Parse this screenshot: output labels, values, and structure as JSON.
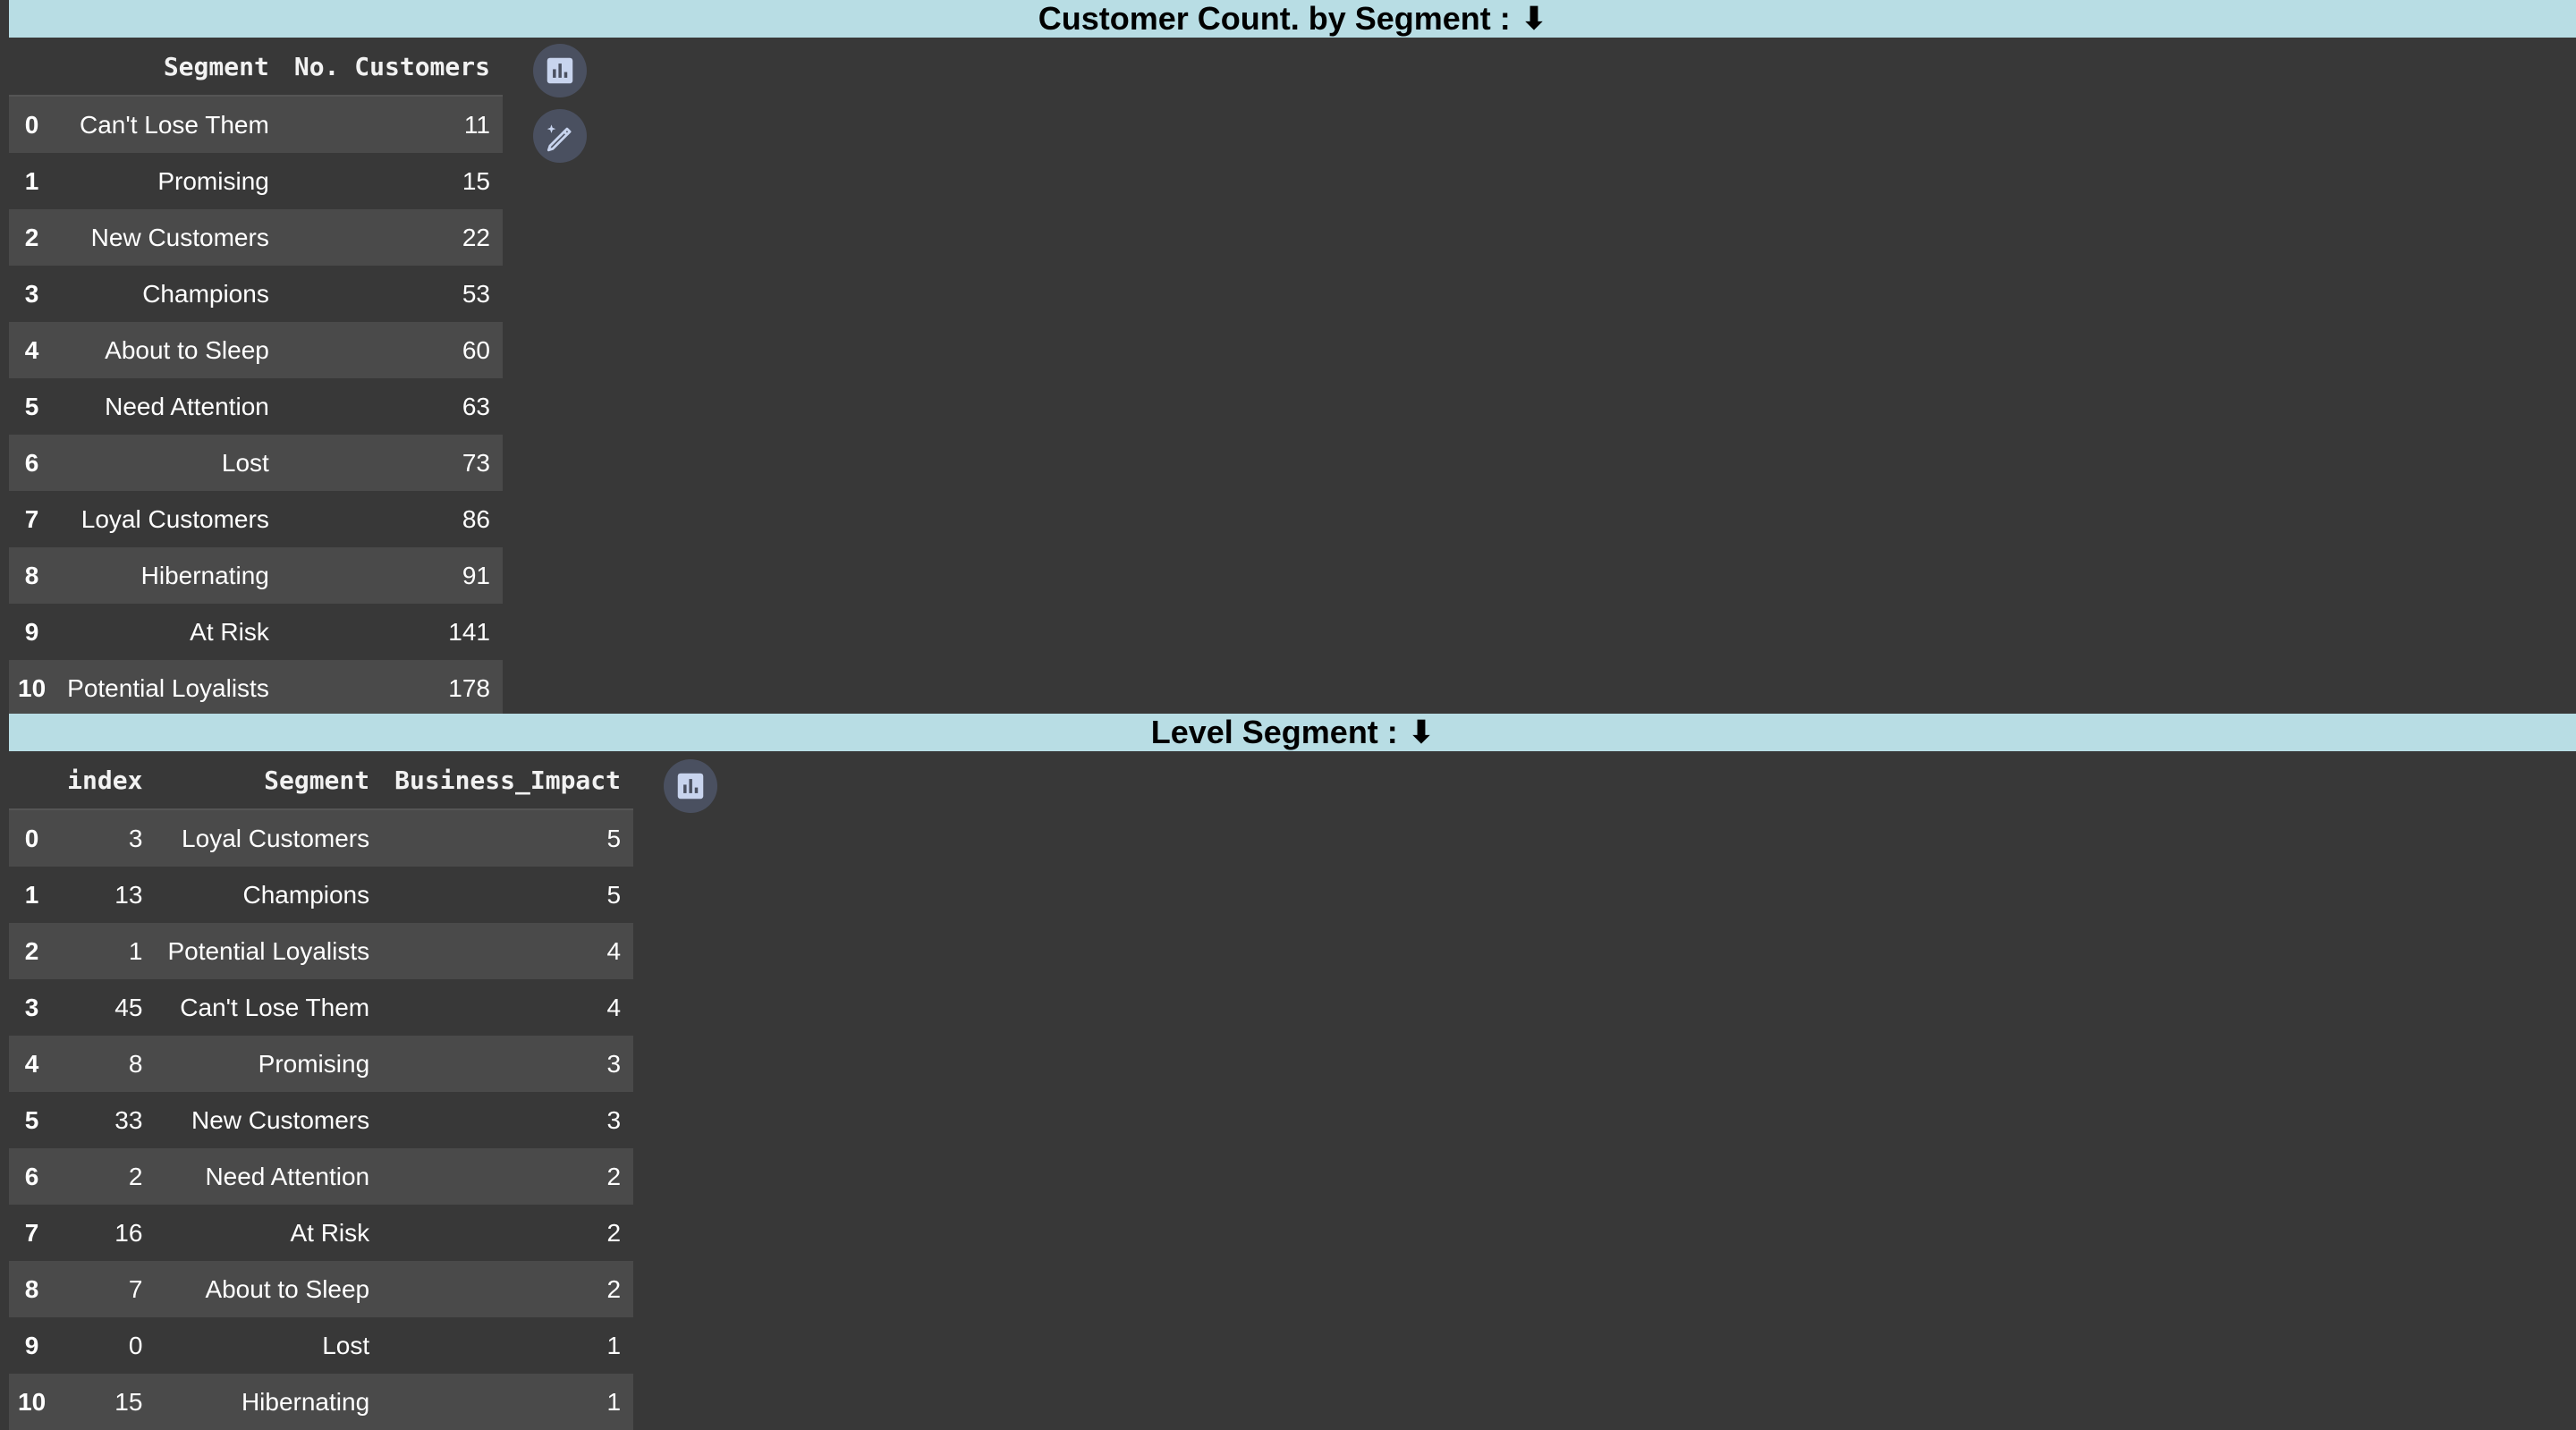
{
  "section1": {
    "title": "Customer Count. by Segment :",
    "arrow": "⬇",
    "columns": [
      "",
      "Segment",
      "No. Customers"
    ],
    "rows": [
      [
        "0",
        "Can't Lose Them",
        "11"
      ],
      [
        "1",
        "Promising",
        "15"
      ],
      [
        "2",
        "New Customers",
        "22"
      ],
      [
        "3",
        "Champions",
        "53"
      ],
      [
        "4",
        "About to Sleep",
        "60"
      ],
      [
        "5",
        "Need Attention",
        "63"
      ],
      [
        "6",
        "Lost",
        "73"
      ],
      [
        "7",
        "Loyal Customers",
        "86"
      ],
      [
        "8",
        "Hibernating",
        "91"
      ],
      [
        "9",
        "At Risk",
        "141"
      ],
      [
        "10",
        "Potential Loyalists",
        "178"
      ]
    ],
    "icons": [
      "bar-chart-icon",
      "magic-edit-icon"
    ]
  },
  "section2": {
    "title": "Level Segment :",
    "arrow": "⬇",
    "columns": [
      "",
      "index",
      "Segment",
      "Business_Impact"
    ],
    "rows": [
      [
        "0",
        "3",
        "Loyal Customers",
        "5"
      ],
      [
        "1",
        "13",
        "Champions",
        "5"
      ],
      [
        "2",
        "1",
        "Potential Loyalists",
        "4"
      ],
      [
        "3",
        "45",
        "Can't Lose Them",
        "4"
      ],
      [
        "4",
        "8",
        "Promising",
        "3"
      ],
      [
        "5",
        "33",
        "New Customers",
        "3"
      ],
      [
        "6",
        "2",
        "Need Attention",
        "2"
      ],
      [
        "7",
        "16",
        "At Risk",
        "2"
      ],
      [
        "8",
        "7",
        "About to Sleep",
        "2"
      ],
      [
        "9",
        "0",
        "Lost",
        "1"
      ],
      [
        "10",
        "15",
        "Hibernating",
        "1"
      ]
    ],
    "icons": [
      "bar-chart-icon"
    ]
  },
  "colors": {
    "banner_bg": "#b8dde4",
    "page_bg": "#383838",
    "row_alt": "#4a4a4a",
    "icon_bg": "#4a5060"
  }
}
